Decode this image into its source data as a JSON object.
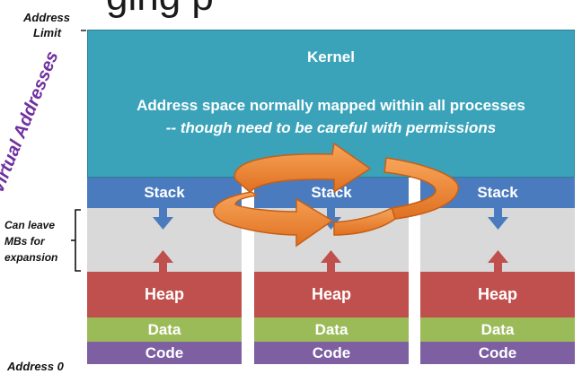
{
  "slide_title_fragment": "ging   p",
  "labels": {
    "address_limit_line1": "Address",
    "address_limit_line2": "Limit",
    "virtual_addresses": "Virtual Addresses",
    "can_leave_line1": "Can leave",
    "can_leave_line2": "MBs for",
    "can_leave_line3": "expansion",
    "address_zero": "Address 0"
  },
  "kernel": {
    "title": "Kernel",
    "line1": "Address space normally mapped within all processes",
    "line2": "-- though need to be careful with permissions"
  },
  "processes": [
    {
      "stack": "Stack",
      "heap": "Heap",
      "data": "Data",
      "code": "Code"
    },
    {
      "stack": "Stack",
      "heap": "Heap",
      "data": "Data",
      "code": "Code"
    },
    {
      "stack": "Stack",
      "heap": "Heap",
      "data": "Data",
      "code": "Code"
    }
  ],
  "colors": {
    "kernel": "#3aa3ba",
    "stack": "#4b7bbf",
    "gap": "#d9d9d9",
    "heap": "#c0504d",
    "data": "#9bbb59",
    "code": "#7d5fa2",
    "context_switch_arrow": "#ed7d31"
  }
}
